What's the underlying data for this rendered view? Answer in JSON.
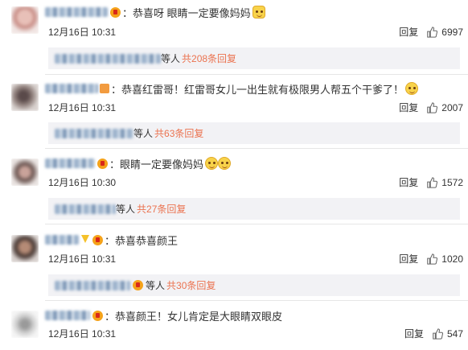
{
  "comments": [
    {
      "text": "：恭喜呀 眼睛一定要像妈妈",
      "date": "12月16日 10:31",
      "reply": "回复",
      "likes": "6997",
      "sub": {
        "who": "等人",
        "link": "共208条回复"
      }
    },
    {
      "text": "：恭喜红雷哥！红雷哥女儿一出生就有极限男人帮五个干爹了！",
      "date": "12月16日 10:31",
      "reply": "回复",
      "likes": "2007",
      "sub": {
        "who": "等人",
        "link": "共63条回复"
      }
    },
    {
      "text": "：眼睛一定要像妈妈",
      "date": "12月16日 10:30",
      "reply": "回复",
      "likes": "1572",
      "sub": {
        "who": "等人",
        "link": "共27条回复"
      }
    },
    {
      "text": "：恭喜恭喜颜王",
      "date": "12月16日 10:31",
      "reply": "回复",
      "likes": "1020",
      "sub": {
        "who": "等人",
        "link": "共30条回复"
      }
    },
    {
      "text": "：恭喜颜王！女儿肯定是大眼睛双眼皮",
      "date": "12月16日 10:31",
      "reply": "回复",
      "likes": "547"
    }
  ]
}
